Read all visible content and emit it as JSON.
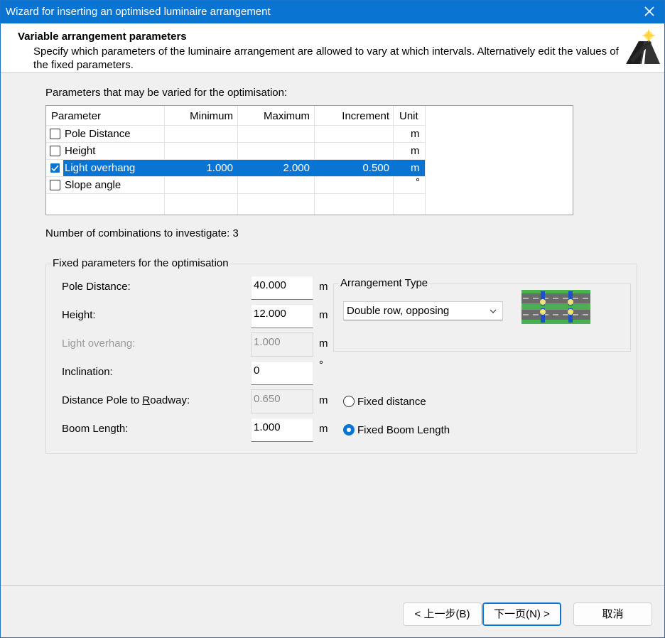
{
  "window": {
    "title": "Wizard for inserting an optimised luminaire arrangement"
  },
  "header": {
    "title": "Variable arrangement parameters",
    "description": "Specify which parameters of the luminaire arrangement are allowed to vary at which intervals. Alternatively edit the values of the fixed parameters."
  },
  "varied": {
    "label": "Parameters that may be varied for the optimisation:",
    "columns": [
      "Parameter",
      "Minimum",
      "Maximum",
      "Increment",
      "Unit"
    ],
    "rows": [
      {
        "name": "Pole Distance",
        "checked": false,
        "min": "",
        "max": "",
        "inc": "",
        "unit": "m"
      },
      {
        "name": "Height",
        "checked": false,
        "min": "",
        "max": "",
        "inc": "",
        "unit": "m"
      },
      {
        "name": "Light overhang",
        "checked": true,
        "min": "1.000",
        "max": "2.000",
        "inc": "0.500",
        "unit": "m"
      },
      {
        "name": "Slope angle",
        "checked": false,
        "min": "",
        "max": "",
        "inc": "",
        "unit": "°"
      }
    ]
  },
  "combinations": "Number of combinations to investigate: 3",
  "fixed": {
    "legend": "Fixed parameters for the optimisation",
    "pole_distance": {
      "label": "Pole Distance:",
      "value": "40.000",
      "unit": "m"
    },
    "height": {
      "label": "Height:",
      "value": "12.000",
      "unit": "m"
    },
    "light_overhang": {
      "label": "Light overhang:",
      "value": "1.000",
      "unit": "m"
    },
    "inclination": {
      "label": "Inclination:",
      "value": "0",
      "unit": "°"
    },
    "distance_pole": {
      "label_pre": "Distance Pole to ",
      "label_acc": "R",
      "label_post": "oadway:",
      "value": "0.650",
      "unit": "m"
    },
    "boom_length": {
      "label": "Boom Length:",
      "value": "1.000",
      "unit": "m"
    },
    "arrangement_type": {
      "legend": "Arrangement Type",
      "selected": "Double row, opposing"
    },
    "radio_fixed_distance": "Fixed distance",
    "radio_fixed_boom": "Fixed Boom Length"
  },
  "buttons": {
    "back": "< 上一步(B)",
    "next": "下一页(N) >",
    "cancel": "取消"
  },
  "colors": {
    "accent": "#0a74d3"
  }
}
